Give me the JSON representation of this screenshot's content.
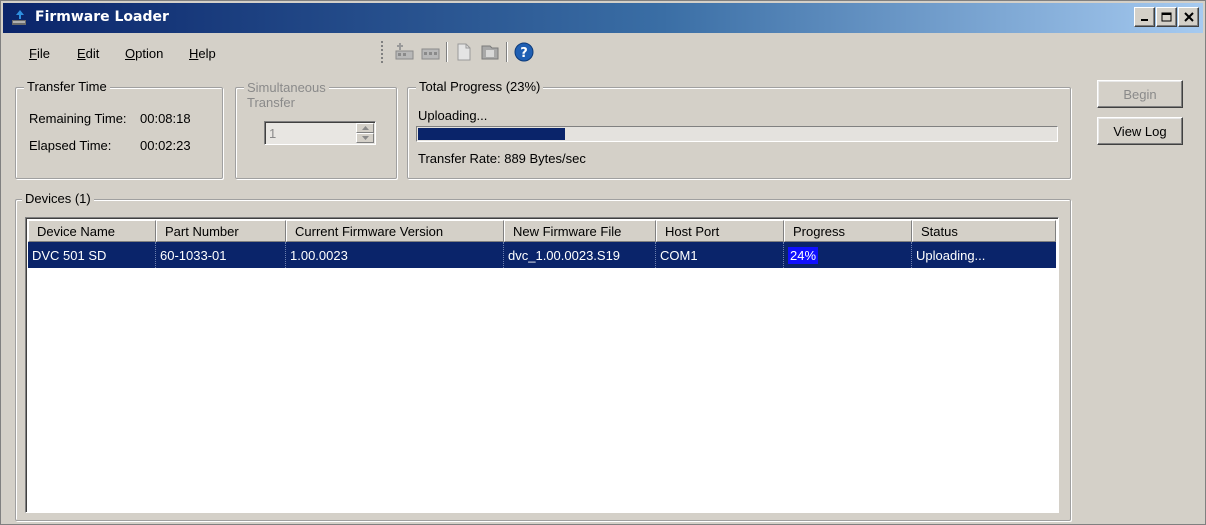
{
  "window": {
    "title": "Firmware Loader",
    "controls": {
      "minimize": "minimize-icon",
      "maximize": "maximize-icon",
      "close": "close-icon"
    }
  },
  "menu": {
    "items": [
      {
        "label": "File",
        "mnemonic": "F",
        "rest": "ile"
      },
      {
        "label": "Edit",
        "mnemonic": "E",
        "rest": "dit"
      },
      {
        "label": "Option",
        "mnemonic": "O",
        "rest": "ption"
      },
      {
        "label": "Help",
        "mnemonic": "H",
        "rest": "elp"
      }
    ]
  },
  "toolbar": {
    "icons": [
      "add-device-icon",
      "remove-device-icon",
      "new-file-icon",
      "open-file-icon",
      "help-icon"
    ]
  },
  "transfer_time": {
    "legend": "Transfer Time",
    "remaining_label": "Remaining Time:",
    "remaining_value": "00:08:18",
    "elapsed_label": "Elapsed Time:",
    "elapsed_value": "00:02:23"
  },
  "simultaneous": {
    "legend_line1": "Simultaneous",
    "legend_line2": "Transfer",
    "value": "1"
  },
  "total_progress": {
    "legend": "Total Progress (23%)",
    "status": "Uploading...",
    "percent": 23,
    "rate": "Transfer Rate: 889 Bytes/sec"
  },
  "buttons": {
    "begin": "Begin",
    "view_log": "View Log"
  },
  "devices": {
    "legend": "Devices (1)",
    "columns": [
      "Device Name",
      "Part Number",
      "Current Firmware Version",
      "New Firmware File",
      "Host Port",
      "Progress",
      "Status"
    ],
    "rows": [
      {
        "device_name": "DVC 501 SD",
        "part_number": "60-1033-01",
        "current_version": "1.00.0023",
        "new_file": "dvc_1.00.0023.S19",
        "host_port": "COM1",
        "progress": "24%",
        "status": "Uploading..."
      }
    ]
  },
  "colors": {
    "selection": "#0a246a",
    "progress_fill": "#0a246a",
    "window_bg": "#d4d0c8"
  }
}
